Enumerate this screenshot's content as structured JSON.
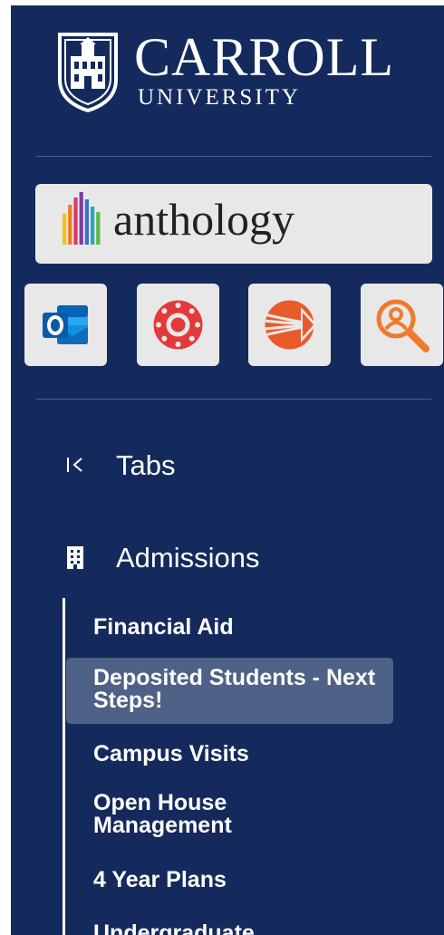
{
  "brand": {
    "name": "CARROLL",
    "subtitle": "UNIVERSITY"
  },
  "anthology": {
    "label": "anthology",
    "bar_colors": [
      "#f0c419",
      "#ef7c22",
      "#d63a6b",
      "#7a3fa0",
      "#3b6fd1",
      "#2aa6b8",
      "#59b847"
    ]
  },
  "apps": [
    {
      "icon": "outlook-icon",
      "color": "#0f6cbd"
    },
    {
      "icon": "canvas-icon",
      "color": "#e23a3a"
    },
    {
      "icon": "kaltura-icon",
      "color": "#e95a2b"
    },
    {
      "icon": "people-search-icon",
      "color": "#f07a2b"
    }
  ],
  "nav": {
    "tabs_label": "Tabs",
    "section_label": "Admissions",
    "items": [
      {
        "label": "Financial Aid",
        "active": false
      },
      {
        "label": "Deposited Students - Next Steps!",
        "active": true
      },
      {
        "label": "Campus Visits",
        "active": false
      },
      {
        "label": "Open House Management",
        "active": false
      },
      {
        "label": "4 Year Plans",
        "active": false
      },
      {
        "label": "Undergraduate",
        "active": false
      }
    ]
  },
  "colors": {
    "sidebar_bg": "#152a5c",
    "active_bg": "#4e6187",
    "tile_bg": "#e8e8e8"
  }
}
